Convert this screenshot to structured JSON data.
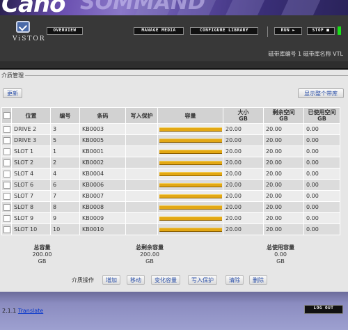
{
  "header": {
    "banner_text": "Caho",
    "brand": "ViSTOR",
    "nav": {
      "overview": "OVERVIEW",
      "manage_media": "MANAGE MEDIA",
      "configure_library": "CONFIGURE LIBRARY",
      "run": "RUN ►",
      "stop": "STOP ■"
    },
    "library_info": "磁带库编号 1 磁带库名称 VTL",
    "status_color": "#19e019"
  },
  "section": {
    "title": "介质管理",
    "refresh_label": "更新",
    "show_all_label": "显示整个带库"
  },
  "table": {
    "headers": {
      "position": "位置",
      "number": "编号",
      "barcode": "条码",
      "write_protect": "写入保护",
      "capacity": "容量",
      "size": "大小\nGB",
      "free": "剩余空间\nGB",
      "used": "已使用空间\nGB"
    },
    "rows": [
      {
        "position": "DRIVE 2",
        "number": "3",
        "barcode": "KB0003",
        "write_protect": "",
        "fill": 1.0,
        "size": "20.00",
        "free": "20.00",
        "used": "0.00"
      },
      {
        "position": "DRIVE 3",
        "number": "5",
        "barcode": "KB0005",
        "write_protect": "",
        "fill": 1.0,
        "size": "20.00",
        "free": "20.00",
        "used": "0.00"
      },
      {
        "position": "SLOT 1",
        "number": "1",
        "barcode": "KB0001",
        "write_protect": "",
        "fill": 1.0,
        "size": "20.00",
        "free": "20.00",
        "used": "0.00"
      },
      {
        "position": "SLOT 2",
        "number": "2",
        "barcode": "KB0002",
        "write_protect": "",
        "fill": 1.0,
        "size": "20.00",
        "free": "20.00",
        "used": "0.00"
      },
      {
        "position": "SLOT 4",
        "number": "4",
        "barcode": "KB0004",
        "write_protect": "",
        "fill": 1.0,
        "size": "20.00",
        "free": "20.00",
        "used": "0.00"
      },
      {
        "position": "SLOT 6",
        "number": "6",
        "barcode": "KB0006",
        "write_protect": "",
        "fill": 1.0,
        "size": "20.00",
        "free": "20.00",
        "used": "0.00"
      },
      {
        "position": "SLOT 7",
        "number": "7",
        "barcode": "KB0007",
        "write_protect": "",
        "fill": 1.0,
        "size": "20.00",
        "free": "20.00",
        "used": "0.00"
      },
      {
        "position": "SLOT 8",
        "number": "8",
        "barcode": "KB0008",
        "write_protect": "",
        "fill": 1.0,
        "size": "20.00",
        "free": "20.00",
        "used": "0.00"
      },
      {
        "position": "SLOT 9",
        "number": "9",
        "barcode": "KB0009",
        "write_protect": "",
        "fill": 1.0,
        "size": "20.00",
        "free": "20.00",
        "used": "0.00"
      },
      {
        "position": "SLOT 10",
        "number": "10",
        "barcode": "KB0010",
        "write_protect": "",
        "fill": 1.0,
        "size": "20.00",
        "free": "20.00",
        "used": "0.00"
      }
    ]
  },
  "totals": {
    "total_label": "总容量",
    "total_value": "200.00",
    "total_unit": "GB",
    "free_label": "总剩余容量",
    "free_value": "200.00",
    "free_unit": "GB",
    "used_label": "总使用容量",
    "used_value": "0.00",
    "used_unit": "GB"
  },
  "operations": {
    "label": "介质操作",
    "add": "增加",
    "move": "移动",
    "change_capacity": "变化容量",
    "write_protect": "写入保护",
    "clear": "清除",
    "delete": "删除"
  },
  "footer": {
    "version": "2.1.1",
    "translate_link": "Translate",
    "logout": "LOG OUT"
  },
  "colors": {
    "capacity_bar": "#e3a814",
    "link": "#2a4fa8"
  }
}
